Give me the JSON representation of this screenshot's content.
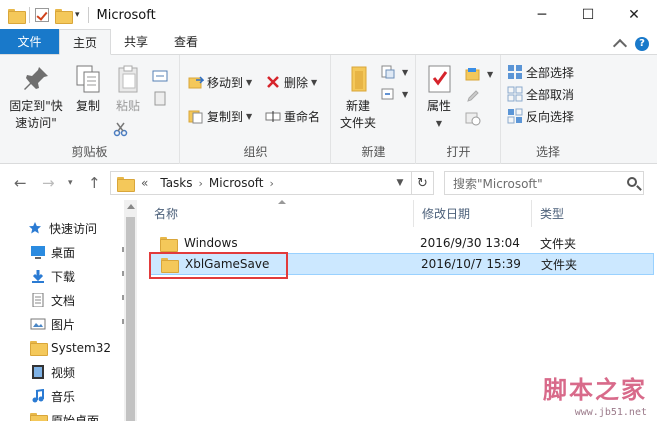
{
  "window": {
    "title": "Microsoft",
    "controls": {
      "minimize": "─",
      "maximize": "☐",
      "close": "✕"
    }
  },
  "quick_access_toolbar": {
    "dropdown": "▾"
  },
  "tabs": [
    {
      "label": "文件"
    },
    {
      "label": "主页"
    },
    {
      "label": "共享"
    },
    {
      "label": "查看"
    }
  ],
  "ribbon": {
    "clipboard": {
      "label": "剪贴板",
      "pin_line1": "固定到\"快",
      "pin_line2": "速访问\"",
      "copy": "复制",
      "paste": "粘贴"
    },
    "organize": {
      "label": "组织",
      "move_to": "移动到",
      "copy_to": "复制到",
      "delete": "删除",
      "rename": "重命名"
    },
    "new": {
      "label": "新建",
      "new_folder_line1": "新建",
      "new_folder_line2": "文件夹"
    },
    "open": {
      "label": "打开",
      "properties": "属性"
    },
    "select": {
      "label": "选择",
      "select_all": "全部选择",
      "select_none": "全部取消",
      "invert": "反向选择"
    }
  },
  "address": {
    "overflow": "«",
    "crumbs": [
      "Tasks",
      "Microsoft"
    ],
    "search_placeholder": "搜索\"Microsoft\""
  },
  "nav_pane": {
    "quick_access": "快速访问",
    "items": [
      {
        "label": "桌面",
        "icon": "desktop-icon",
        "pinned": true
      },
      {
        "label": "下载",
        "icon": "download-icon",
        "pinned": true
      },
      {
        "label": "文档",
        "icon": "document-icon",
        "pinned": true
      },
      {
        "label": "图片",
        "icon": "picture-icon",
        "pinned": true
      },
      {
        "label": "System32",
        "icon": "folder-icon",
        "pinned": false
      },
      {
        "label": "视频",
        "icon": "video-icon",
        "pinned": false
      },
      {
        "label": "音乐",
        "icon": "music-icon",
        "pinned": false
      },
      {
        "label": "原始桌面",
        "icon": "folder-icon",
        "pinned": false
      }
    ]
  },
  "file_list": {
    "columns": [
      "名称",
      "修改日期",
      "类型"
    ],
    "rows": [
      {
        "name": "Windows",
        "date": "2016/9/30 13:04",
        "type": "文件夹",
        "selected": false
      },
      {
        "name": "XblGameSave",
        "date": "2016/10/7 15:39",
        "type": "文件夹",
        "selected": true
      }
    ]
  },
  "watermark": {
    "main": "脚本之家",
    "sub": "www.jb51.net"
  },
  "colors": {
    "accent": "#1979ca",
    "selection": "#cce8ff",
    "highlight_box": "#e23b3b",
    "folder": "#f4c85a"
  }
}
